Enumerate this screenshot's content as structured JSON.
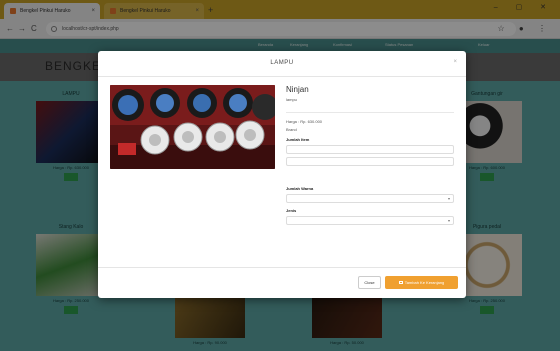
{
  "browser": {
    "tabs": [
      {
        "label": "Bengkel Pinkui Haruko"
      },
      {
        "label": "Bengkel Pinkui Haruko"
      }
    ],
    "new_tab": "+",
    "window_controls": "– ▢ ✕",
    "nav": {
      "back": "←",
      "forward": "→",
      "reload": "C"
    },
    "url": "localhost/cr-spt/index.php",
    "star": "☆",
    "menu": "⋮"
  },
  "page": {
    "brand": "BENGKE",
    "topnav": [
      "Beranda",
      "Keranjang",
      "Konfirmasi",
      "Status Pesanan",
      "Keluar"
    ],
    "products": [
      {
        "category": "LAMPU",
        "price": "Harga : Rp. 630.000"
      },
      {
        "category": "Gantungan gir",
        "price": "Harga : Rp. 600.000"
      },
      {
        "category": "Stang Kalo",
        "price": "Harga : Rp. 250.000"
      },
      {
        "category": "Pigura pedal",
        "price": "Harga : Rp. 250.000"
      }
    ],
    "bottom_prices": [
      "Harga : Rp. 90.000",
      "Harga : Rp. 50.000"
    ]
  },
  "modal": {
    "title": "LAMPU",
    "close_icon": "×",
    "product_name": "Ninjan",
    "product_sub": "lampu",
    "price": "Harga : Rp. 630.000",
    "status": "Brand",
    "label_qty": "Jumlah Item",
    "label_variant": "Jumlah Warna",
    "label_type": "Jenis",
    "btn_close": "Close",
    "btn_add": "Tambah Ke Keranjang"
  },
  "colors": {
    "page_bg": "#5ea8a6",
    "tab_bar": "#c9a227",
    "add_button": "#f0a030",
    "buy_button": "#2e9e4f"
  }
}
